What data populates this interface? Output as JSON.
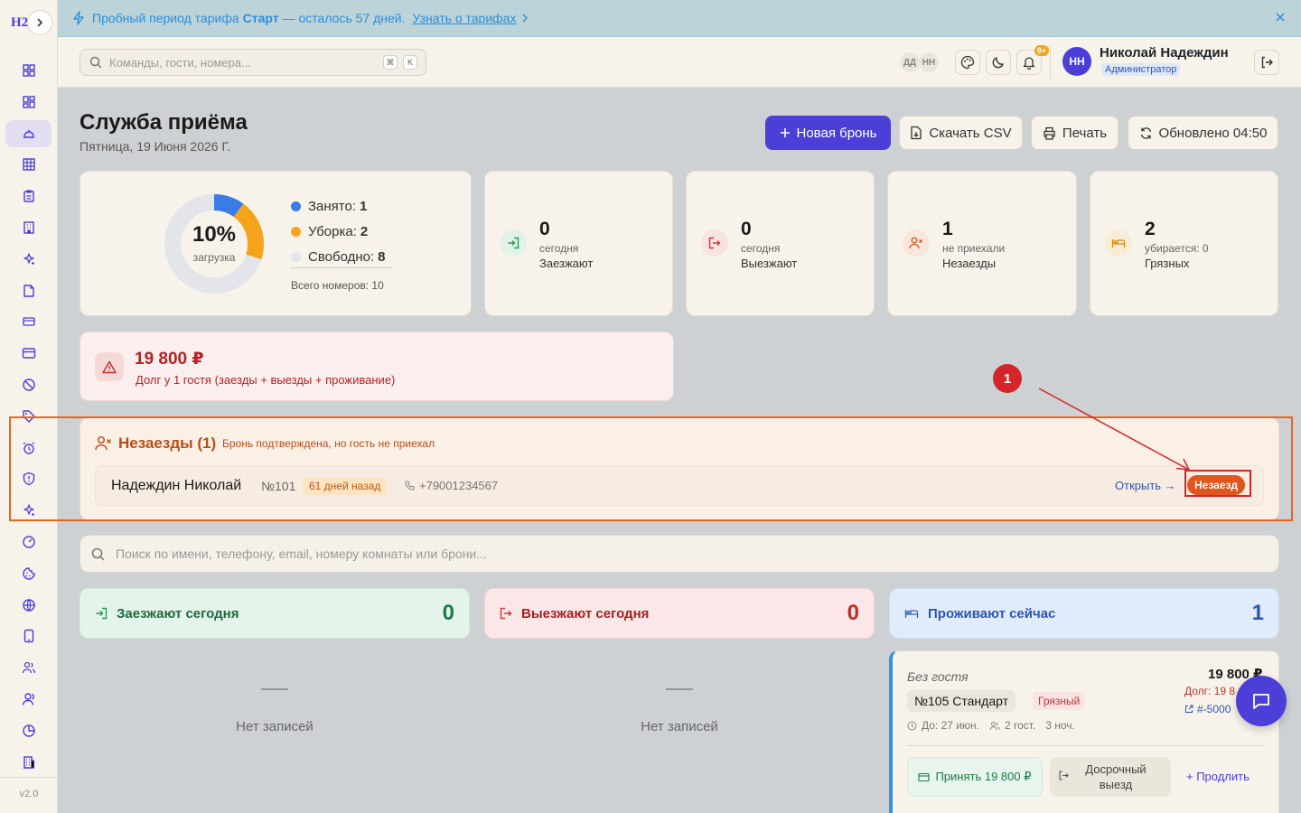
{
  "sidebar": {
    "logo": "H2",
    "version": "v2.0",
    "active_index": 2,
    "items": [
      "dashboard-icon",
      "grid-icon",
      "reception-bell-icon",
      "table-icon",
      "clipboard-icon",
      "building-icon",
      "sparkle-icon",
      "document-icon",
      "card-icon",
      "credit-card-icon",
      "ban-icon",
      "tag-icon",
      "alarm-icon",
      "shield-icon",
      "sparkle-icon",
      "gauge-icon",
      "cookie-icon",
      "globe-icon",
      "tablet-icon",
      "users-icon",
      "team-icon",
      "pie-chart-icon",
      "office-icon"
    ]
  },
  "banner": {
    "prefix": "Пробный период тарифа",
    "plan": "Старт",
    "suffix": "— осталось 57 дней.",
    "link": "Узнать о тарифах"
  },
  "topbar": {
    "search_placeholder": "Команды, гости, номера...",
    "kbd1": "⌘",
    "kbd2": "K",
    "avatar1": "ДД",
    "avatar2": "НН",
    "notif_count": "9+",
    "user_initials": "НН",
    "user_name": "Николай Надеждин",
    "user_role": "Администратор"
  },
  "header": {
    "title": "Служба приёма",
    "date": "Пятница, 19 Июня 2026 Г.",
    "new_booking": "Новая бронь",
    "download_csv": "Скачать CSV",
    "print": "Печать",
    "updated": "Обновлено 04:50"
  },
  "occupancy": {
    "percent": "10%",
    "label": "загрузка",
    "occupied_label": "Занято:",
    "occupied": "1",
    "cleaning_label": "Уборка:",
    "cleaning": "2",
    "free_label": "Свободно:",
    "free": "8",
    "total": "Всего номеров: 10",
    "fractions": {
      "occupied": 0.1,
      "cleaning": 0.2,
      "free": 0.7
    },
    "colors": {
      "occupied": "#3a7be6",
      "cleaning": "#f5a31a",
      "free": "#e3e5eb"
    }
  },
  "stats": [
    {
      "value": "0",
      "sub": "сегодня",
      "label": "Заезжают"
    },
    {
      "value": "0",
      "sub": "сегодня",
      "label": "Выезжают"
    },
    {
      "value": "1",
      "sub": "не приехали",
      "label": "Незаезды"
    },
    {
      "value": "2",
      "sub": "убирается: 0",
      "label": "Грязных"
    }
  ],
  "debt": {
    "amount": "19 800 ₽",
    "description": "Долг у 1 гостя (заезды + выезды + проживание)"
  },
  "noshows": {
    "title": "Незаезды (1)",
    "subtitle": "Бронь подтверждена, но гость не приехал",
    "row": {
      "name": "Надеждин Николай",
      "room": "№101",
      "days": "61 дней назад",
      "phone": "+79001234567",
      "open": "Открыть →",
      "badge": "Незаезд"
    }
  },
  "annotation": {
    "number": "1"
  },
  "guest_search_placeholder": "Поиск по имени, телефону, email, номеру комнаты или брони...",
  "columns": {
    "arrivals": {
      "title": "Заезжают сегодня",
      "count": "0",
      "empty": "Нет записей"
    },
    "departures": {
      "title": "Выезжают сегодня",
      "count": "0",
      "empty": "Нет записей"
    },
    "staying": {
      "title": "Проживают сейчас",
      "count": "1"
    }
  },
  "stay_card": {
    "guest": "Без гостя",
    "room": "№105 Стандарт",
    "status": "Грязный",
    "amount": "19 800 ₽",
    "debt": "Долг: 19 8",
    "booking": "#-5000",
    "until": "До: 27 июн.",
    "guests": "2 гост.",
    "nights": "3 ноч.",
    "accept": "Принять 19 800 ₽",
    "early_checkout": "Досрочный выезд",
    "extend": "+ Продлить"
  }
}
